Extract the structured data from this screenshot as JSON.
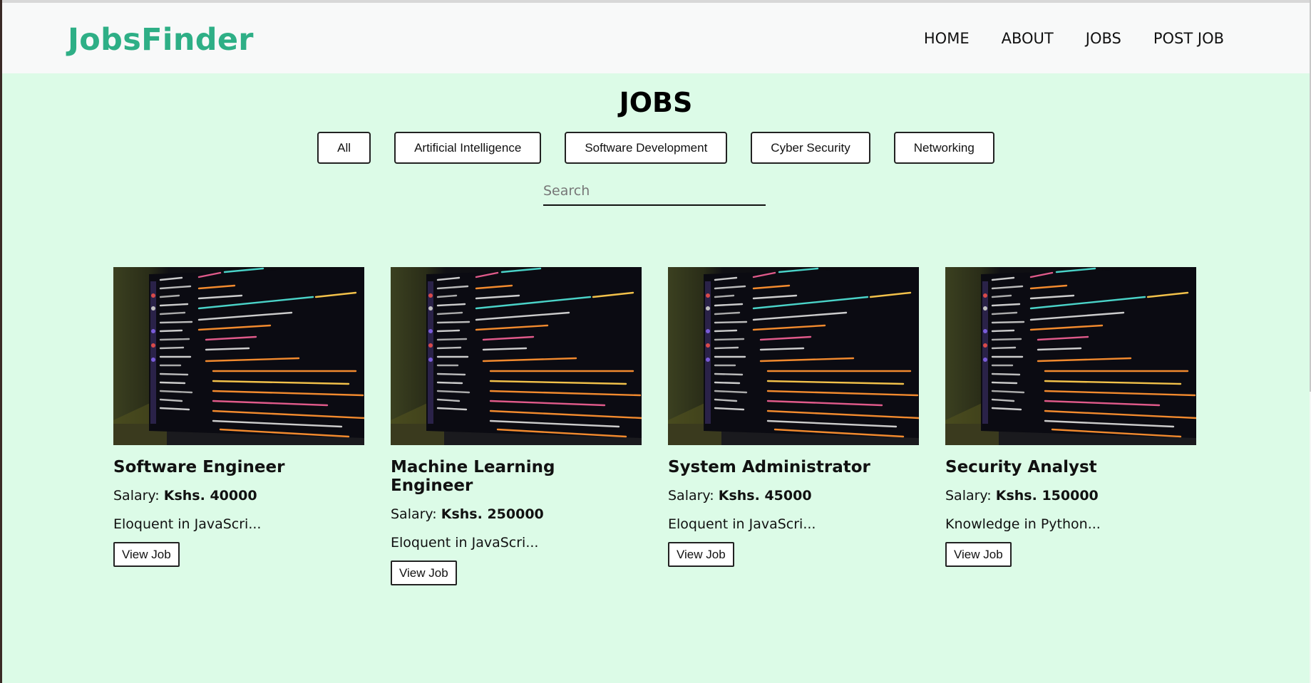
{
  "brand": {
    "name": "JobsFinder",
    "color": "#2eaf86"
  },
  "nav": {
    "links": [
      "HOME",
      "ABOUT",
      "JOBS",
      "POST JOB"
    ]
  },
  "page": {
    "title": "JOBS",
    "background": "#dcfbe7"
  },
  "filters": [
    "All",
    "Artificial Intelligence",
    "Software Development",
    "Cyber Security",
    "Networking"
  ],
  "search": {
    "placeholder": "Search",
    "value": ""
  },
  "jobs": [
    {
      "title": "Software Engineer",
      "salary_label": "Salary:",
      "salary": "Kshs. 40000",
      "description": "Eloquent in JavaScri...",
      "button": "View Job",
      "image": "code-screen-image"
    },
    {
      "title": "Machine Learning Engineer",
      "salary_label": "Salary:",
      "salary": "Kshs. 250000",
      "description": "Eloquent in JavaScri...",
      "button": "View Job",
      "image": "code-screen-image"
    },
    {
      "title": "System Administrator",
      "salary_label": "Salary:",
      "salary": "Kshs. 45000",
      "description": "Eloquent in JavaScri...",
      "button": "View Job",
      "image": "code-screen-image"
    },
    {
      "title": "Security Analyst",
      "salary_label": "Salary:",
      "salary": "Kshs. 150000",
      "description": "Knowledge in Python...",
      "button": "View Job",
      "image": "code-screen-image"
    }
  ]
}
